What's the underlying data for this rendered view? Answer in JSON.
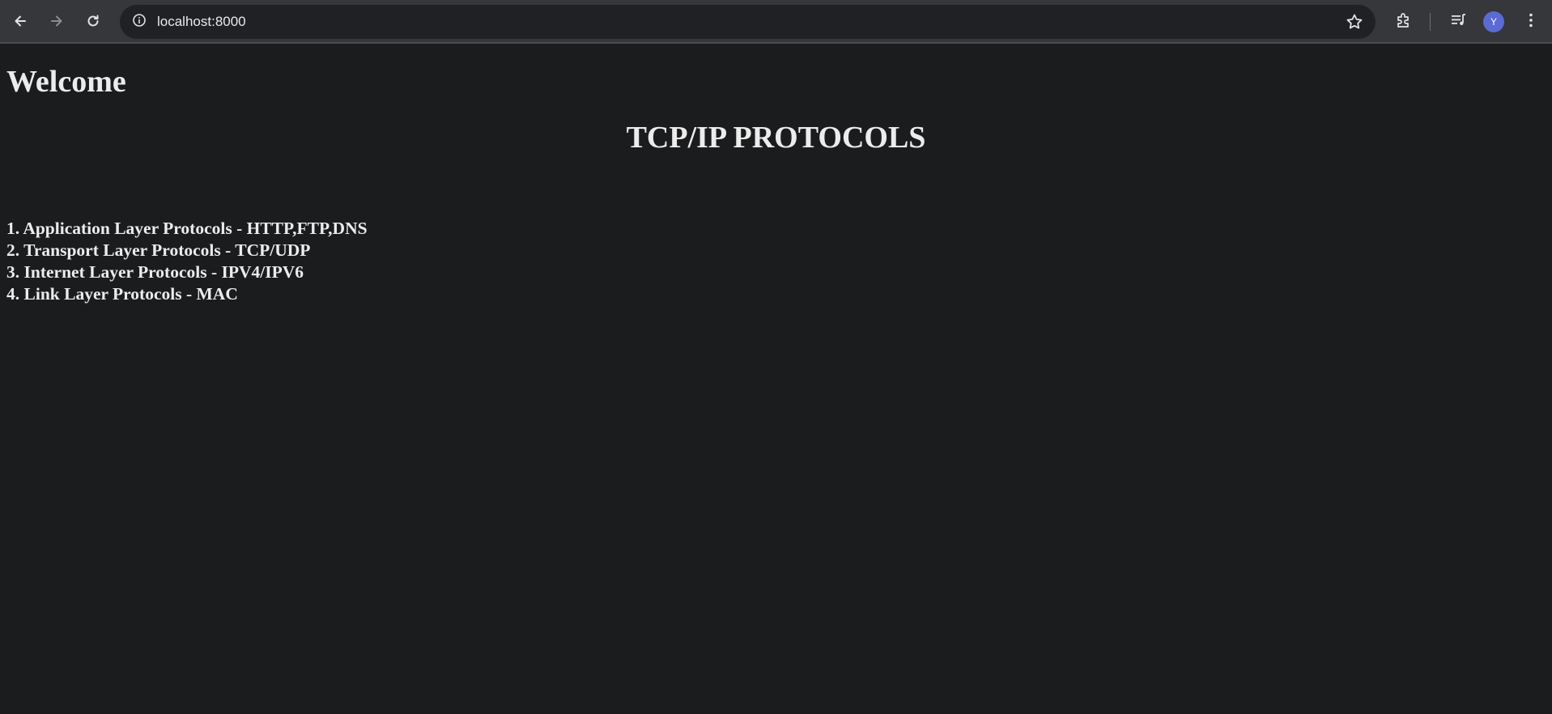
{
  "browser": {
    "url": "localhost:8000",
    "profile_initial": "Y",
    "colors": {
      "toolbar": "#35373a",
      "omnibox": "#202124",
      "avatar": "#5b6ad4"
    },
    "icons": [
      "back-arrow-icon",
      "forward-arrow-icon",
      "reload-icon",
      "site-info-icon",
      "bookmark-star-icon",
      "extensions-icon",
      "media-queue-icon",
      "more-menu-icon"
    ]
  },
  "page": {
    "welcome": "Welcome",
    "title": "TCP/IP PROTOCOLS",
    "protocols": [
      "1. Application Layer Protocols - HTTP,FTP,DNS",
      "2. Transport Layer Protocols - TCP/UDP",
      "3. Internet Layer Protocols - IPV4/IPV6",
      "4. Link Layer Protocols - MAC"
    ],
    "colors": {
      "background": "#1b1c1e",
      "text": "#ececec"
    }
  }
}
